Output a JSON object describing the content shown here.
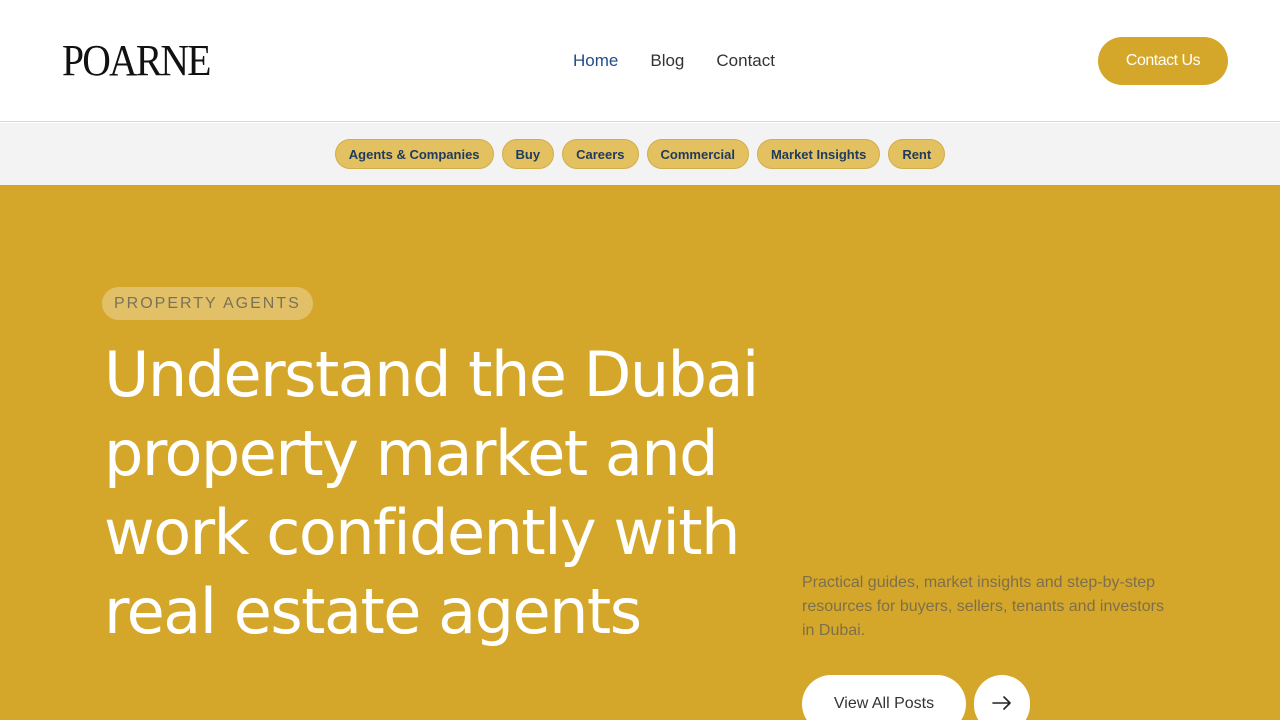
{
  "header": {
    "logo_text": "POARNE",
    "nav": [
      {
        "label": "Home",
        "active": true
      },
      {
        "label": "Blog",
        "active": false
      },
      {
        "label": "Contact",
        "active": false
      }
    ],
    "cta_label": "Contact Us"
  },
  "categories": [
    "Agents & Companies",
    "Buy",
    "Careers",
    "Commercial",
    "Market Insights",
    "Rent"
  ],
  "hero": {
    "eyebrow": "PROPERTY AGENTS",
    "headline": "Understand the Dubai property market and work confidently with real estate agents",
    "description": "Practical guides, market insights and step-by-step resources for buyers, sellers, tenants and investors in Dubai.",
    "button_label": "View All Posts",
    "arrow_icon": "arrow-right-icon"
  },
  "colors": {
    "accent": "#d4a72a",
    "chip_bg": "#e3c060",
    "nav_active": "#1e4d8a",
    "category_bar_bg": "#f3f3f3"
  }
}
